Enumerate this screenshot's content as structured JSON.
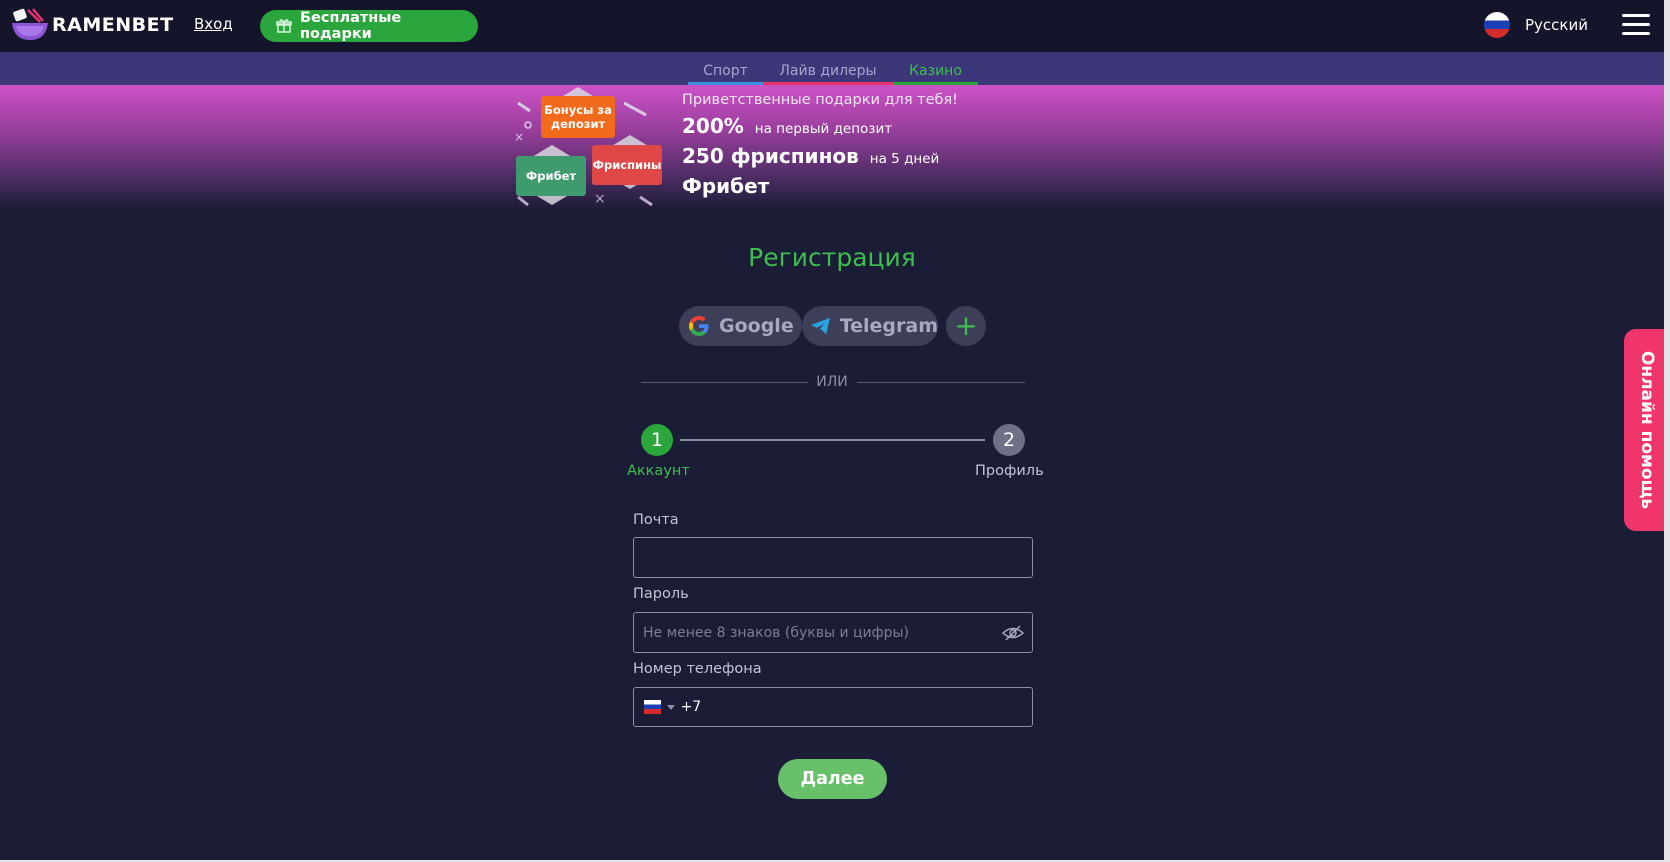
{
  "header": {
    "logo_text": "RAMENBET",
    "login_label": "Вход",
    "gifts_label": "Бесплатные подарки",
    "language_label": "Русский"
  },
  "tabs": [
    {
      "label": "Спорт",
      "color": "#3f8fe0"
    },
    {
      "label": "Лайв дилеры",
      "color": "#e6336f"
    },
    {
      "label": "Казино",
      "color": "#2aa63c",
      "active": true
    }
  ],
  "banner": {
    "boxes": {
      "deposit_bonus": "Бонусы за депозит",
      "freebet": "Фрибет",
      "freespins": "Фриспины"
    },
    "subtitle": "Приветственные подарки для тебя!",
    "line1_big": "200%",
    "line1_small": "на первый депозит",
    "line2_big": "250 фриспинов",
    "line2_small": "на 5 дней",
    "line3_big": "Фрибет"
  },
  "registration": {
    "title": "Регистрация",
    "social": {
      "google_label": "Google",
      "telegram_label": "Telegram",
      "more_label": "+"
    },
    "or_label": "ИЛИ",
    "steps": [
      {
        "number": "1",
        "label": "Аккаунт",
        "active": true
      },
      {
        "number": "2",
        "label": "Профиль",
        "active": false
      }
    ],
    "email_label": "Почта",
    "email_value": "",
    "password_label": "Пароль",
    "password_placeholder": "Не менее 8 знаков (буквы и цифры)",
    "phone_label": "Номер телефона",
    "phone_code": "+7",
    "next_label": "Далее"
  },
  "help_label": "Онлайн помощь",
  "colors": {
    "accent_green": "#3cbe4e",
    "background": "#1b1c35",
    "header": "#14152a",
    "help_pink": "#f0356b"
  }
}
